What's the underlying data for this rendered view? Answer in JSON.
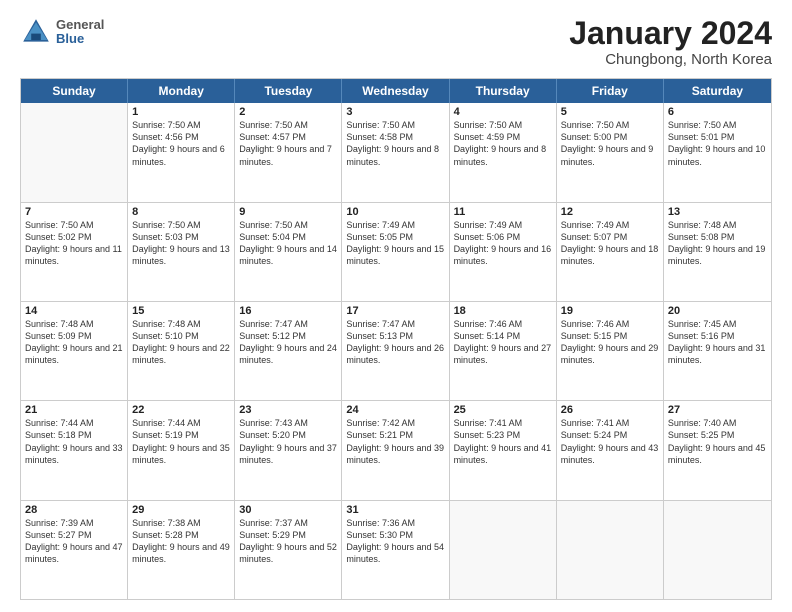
{
  "header": {
    "logo": {
      "general": "General",
      "blue": "Blue"
    },
    "title": "January 2024",
    "location": "Chungbong, North Korea"
  },
  "weekdays": [
    "Sunday",
    "Monday",
    "Tuesday",
    "Wednesday",
    "Thursday",
    "Friday",
    "Saturday"
  ],
  "rows": [
    [
      {
        "day": "",
        "sunrise": "",
        "sunset": "",
        "daylight": ""
      },
      {
        "day": "1",
        "sunrise": "Sunrise: 7:50 AM",
        "sunset": "Sunset: 4:56 PM",
        "daylight": "Daylight: 9 hours and 6 minutes."
      },
      {
        "day": "2",
        "sunrise": "Sunrise: 7:50 AM",
        "sunset": "Sunset: 4:57 PM",
        "daylight": "Daylight: 9 hours and 7 minutes."
      },
      {
        "day": "3",
        "sunrise": "Sunrise: 7:50 AM",
        "sunset": "Sunset: 4:58 PM",
        "daylight": "Daylight: 9 hours and 8 minutes."
      },
      {
        "day": "4",
        "sunrise": "Sunrise: 7:50 AM",
        "sunset": "Sunset: 4:59 PM",
        "daylight": "Daylight: 9 hours and 8 minutes."
      },
      {
        "day": "5",
        "sunrise": "Sunrise: 7:50 AM",
        "sunset": "Sunset: 5:00 PM",
        "daylight": "Daylight: 9 hours and 9 minutes."
      },
      {
        "day": "6",
        "sunrise": "Sunrise: 7:50 AM",
        "sunset": "Sunset: 5:01 PM",
        "daylight": "Daylight: 9 hours and 10 minutes."
      }
    ],
    [
      {
        "day": "7",
        "sunrise": "Sunrise: 7:50 AM",
        "sunset": "Sunset: 5:02 PM",
        "daylight": "Daylight: 9 hours and 11 minutes."
      },
      {
        "day": "8",
        "sunrise": "Sunrise: 7:50 AM",
        "sunset": "Sunset: 5:03 PM",
        "daylight": "Daylight: 9 hours and 13 minutes."
      },
      {
        "day": "9",
        "sunrise": "Sunrise: 7:50 AM",
        "sunset": "Sunset: 5:04 PM",
        "daylight": "Daylight: 9 hours and 14 minutes."
      },
      {
        "day": "10",
        "sunrise": "Sunrise: 7:49 AM",
        "sunset": "Sunset: 5:05 PM",
        "daylight": "Daylight: 9 hours and 15 minutes."
      },
      {
        "day": "11",
        "sunrise": "Sunrise: 7:49 AM",
        "sunset": "Sunset: 5:06 PM",
        "daylight": "Daylight: 9 hours and 16 minutes."
      },
      {
        "day": "12",
        "sunrise": "Sunrise: 7:49 AM",
        "sunset": "Sunset: 5:07 PM",
        "daylight": "Daylight: 9 hours and 18 minutes."
      },
      {
        "day": "13",
        "sunrise": "Sunrise: 7:48 AM",
        "sunset": "Sunset: 5:08 PM",
        "daylight": "Daylight: 9 hours and 19 minutes."
      }
    ],
    [
      {
        "day": "14",
        "sunrise": "Sunrise: 7:48 AM",
        "sunset": "Sunset: 5:09 PM",
        "daylight": "Daylight: 9 hours and 21 minutes."
      },
      {
        "day": "15",
        "sunrise": "Sunrise: 7:48 AM",
        "sunset": "Sunset: 5:10 PM",
        "daylight": "Daylight: 9 hours and 22 minutes."
      },
      {
        "day": "16",
        "sunrise": "Sunrise: 7:47 AM",
        "sunset": "Sunset: 5:12 PM",
        "daylight": "Daylight: 9 hours and 24 minutes."
      },
      {
        "day": "17",
        "sunrise": "Sunrise: 7:47 AM",
        "sunset": "Sunset: 5:13 PM",
        "daylight": "Daylight: 9 hours and 26 minutes."
      },
      {
        "day": "18",
        "sunrise": "Sunrise: 7:46 AM",
        "sunset": "Sunset: 5:14 PM",
        "daylight": "Daylight: 9 hours and 27 minutes."
      },
      {
        "day": "19",
        "sunrise": "Sunrise: 7:46 AM",
        "sunset": "Sunset: 5:15 PM",
        "daylight": "Daylight: 9 hours and 29 minutes."
      },
      {
        "day": "20",
        "sunrise": "Sunrise: 7:45 AM",
        "sunset": "Sunset: 5:16 PM",
        "daylight": "Daylight: 9 hours and 31 minutes."
      }
    ],
    [
      {
        "day": "21",
        "sunrise": "Sunrise: 7:44 AM",
        "sunset": "Sunset: 5:18 PM",
        "daylight": "Daylight: 9 hours and 33 minutes."
      },
      {
        "day": "22",
        "sunrise": "Sunrise: 7:44 AM",
        "sunset": "Sunset: 5:19 PM",
        "daylight": "Daylight: 9 hours and 35 minutes."
      },
      {
        "day": "23",
        "sunrise": "Sunrise: 7:43 AM",
        "sunset": "Sunset: 5:20 PM",
        "daylight": "Daylight: 9 hours and 37 minutes."
      },
      {
        "day": "24",
        "sunrise": "Sunrise: 7:42 AM",
        "sunset": "Sunset: 5:21 PM",
        "daylight": "Daylight: 9 hours and 39 minutes."
      },
      {
        "day": "25",
        "sunrise": "Sunrise: 7:41 AM",
        "sunset": "Sunset: 5:23 PM",
        "daylight": "Daylight: 9 hours and 41 minutes."
      },
      {
        "day": "26",
        "sunrise": "Sunrise: 7:41 AM",
        "sunset": "Sunset: 5:24 PM",
        "daylight": "Daylight: 9 hours and 43 minutes."
      },
      {
        "day": "27",
        "sunrise": "Sunrise: 7:40 AM",
        "sunset": "Sunset: 5:25 PM",
        "daylight": "Daylight: 9 hours and 45 minutes."
      }
    ],
    [
      {
        "day": "28",
        "sunrise": "Sunrise: 7:39 AM",
        "sunset": "Sunset: 5:27 PM",
        "daylight": "Daylight: 9 hours and 47 minutes."
      },
      {
        "day": "29",
        "sunrise": "Sunrise: 7:38 AM",
        "sunset": "Sunset: 5:28 PM",
        "daylight": "Daylight: 9 hours and 49 minutes."
      },
      {
        "day": "30",
        "sunrise": "Sunrise: 7:37 AM",
        "sunset": "Sunset: 5:29 PM",
        "daylight": "Daylight: 9 hours and 52 minutes."
      },
      {
        "day": "31",
        "sunrise": "Sunrise: 7:36 AM",
        "sunset": "Sunset: 5:30 PM",
        "daylight": "Daylight: 9 hours and 54 minutes."
      },
      {
        "day": "",
        "sunrise": "",
        "sunset": "",
        "daylight": ""
      },
      {
        "day": "",
        "sunrise": "",
        "sunset": "",
        "daylight": ""
      },
      {
        "day": "",
        "sunrise": "",
        "sunset": "",
        "daylight": ""
      }
    ]
  ]
}
